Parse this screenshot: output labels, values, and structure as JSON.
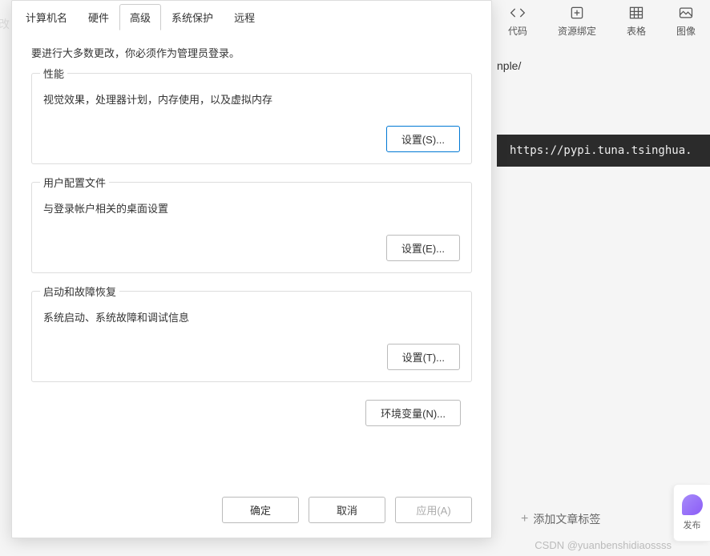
{
  "tabs": {
    "computer_name": "计算机名",
    "hardware": "硬件",
    "advanced": "高级",
    "system_protection": "系统保护",
    "remote": "远程"
  },
  "admin_note": "要进行大多数更改，你必须作为管理员登录。",
  "groups": {
    "performance": {
      "title": "性能",
      "desc": "视觉效果，处理器计划，内存使用，以及虚拟内存",
      "button": "设置(S)..."
    },
    "user_profiles": {
      "title": "用户配置文件",
      "desc": "与登录帐户相关的桌面设置",
      "button": "设置(E)..."
    },
    "startup": {
      "title": "启动和故障恢复",
      "desc": "系统启动、系统故障和调试信息",
      "button": "设置(T)..."
    }
  },
  "env_button": "环境变量(N)...",
  "footer": {
    "ok": "确定",
    "cancel": "取消",
    "apply": "应用(A)"
  },
  "background": {
    "toolbar": {
      "code": "代码",
      "resource": "资源绑定",
      "table": "表格",
      "image": "图像"
    },
    "url_fragment": "nple/",
    "code_line": "https://pypi.tuna.tsinghua.",
    "refresh_label": "改",
    "add_tag": "添加文章标签",
    "fab_label": "发布",
    "watermark": "CSDN @yuanbenshidiaossss"
  }
}
